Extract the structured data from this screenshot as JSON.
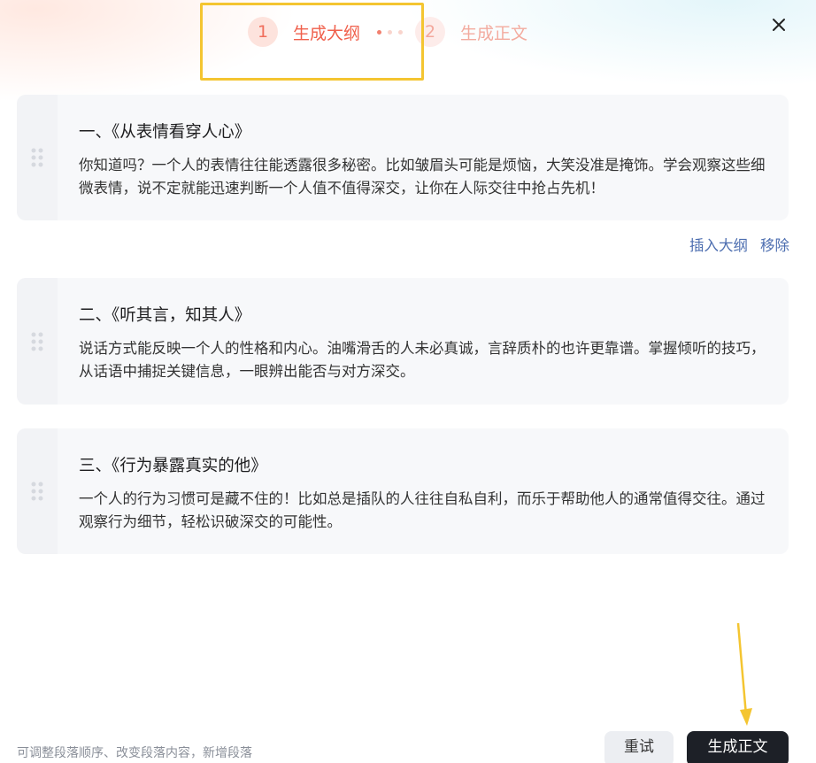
{
  "stepper": {
    "steps": [
      {
        "number": "1",
        "label": "生成大纲"
      },
      {
        "number": "2",
        "label": "生成正文"
      }
    ]
  },
  "outline": {
    "sections": [
      {
        "title": "一、《从表情看穿人心》",
        "text": "你知道吗？一个人的表情往往能透露很多秘密。比如皱眉头可能是烦恼，大笑没准是掩饰。学会观察这些细微表情，说不定就能迅速判断一个人值不值得深交，让你在人际交往中抢占先机！"
      },
      {
        "title": "二、《听其言，知其人》",
        "text": "说话方式能反映一个人的性格和内心。油嘴滑舌的人未必真诚，言辞质朴的也许更靠谱。掌握倾听的技巧，从话语中捕捉关键信息，一眼辨出能否与对方深交。"
      },
      {
        "title": "三、《行为暴露真实的他》",
        "text": "一个人的行为习惯可是藏不住的！比如总是插队的人往往自私自利，而乐于帮助他人的通常值得交往。通过观察行为细节，轻松识破深交的可能性。"
      }
    ],
    "actions": {
      "insert": "插入大纲",
      "remove": "移除"
    }
  },
  "footer": {
    "hint": "可调整段落顺序、改变段落内容，新增段落",
    "retry_label": "重试",
    "generate_label": "生成正文"
  },
  "icons": {
    "close": "close-icon",
    "drag": "drag-handle-icon",
    "arrow": "arrow-down-icon"
  },
  "colors": {
    "accent": "#f0604c",
    "highlight": "#f4c531",
    "link": "#4d6eb0",
    "primary_button": "#1d2027"
  }
}
